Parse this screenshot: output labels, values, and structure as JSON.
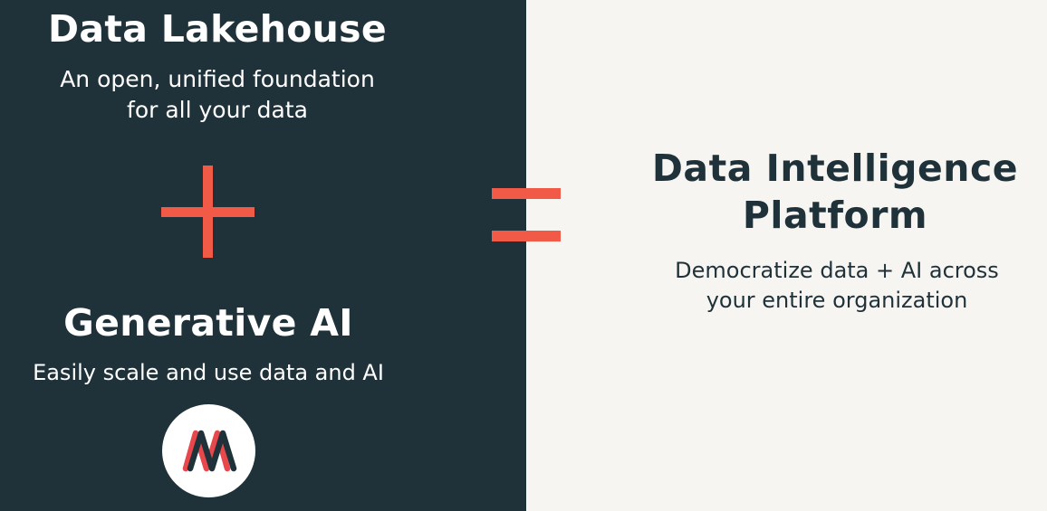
{
  "left": {
    "lakehouse": {
      "title": "Data Lakehouse",
      "subtitle_line1": "An open, unified foundation",
      "subtitle_line2": "for all your data"
    },
    "operator_icon": "plus-icon",
    "generative_ai": {
      "title": "Generative AI",
      "subtitle": "Easily scale and use data and AI"
    },
    "logo_icon": "mosaic-ai-logo"
  },
  "equals_icon": "equals-icon",
  "right": {
    "title_line1": "Data Intelligence",
    "title_line2": "Platform",
    "subtitle_line1": "Democratize data + AI across",
    "subtitle_line2": "your entire organization"
  },
  "colors": {
    "dark_panel": "#1f3139",
    "light_panel": "#f7f5f2",
    "accent": "#f05a47",
    "logo_dark": "#1f3139",
    "logo_red": "#e8474c"
  }
}
